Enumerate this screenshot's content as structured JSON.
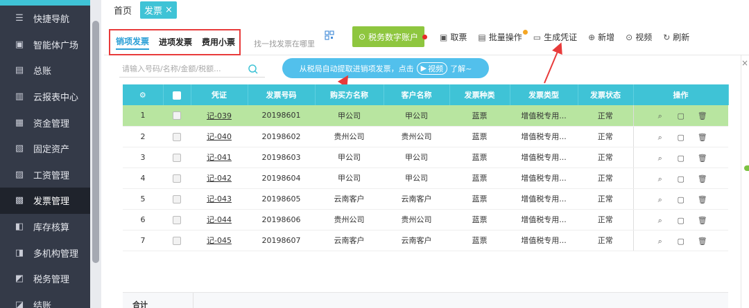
{
  "sidebar": {
    "items": [
      {
        "label": "快捷导航",
        "icon": "navigation-icon"
      },
      {
        "label": "智能体广场",
        "icon": "agent-icon"
      },
      {
        "label": "总账",
        "icon": "ledger-icon"
      },
      {
        "label": "云报表中心",
        "icon": "report-icon"
      },
      {
        "label": "资金管理",
        "icon": "funds-icon"
      },
      {
        "label": "固定资产",
        "icon": "asset-icon"
      },
      {
        "label": "工资管理",
        "icon": "salary-icon"
      },
      {
        "label": "发票管理",
        "icon": "invoice-icon"
      },
      {
        "label": "库存核算",
        "icon": "inventory-icon"
      },
      {
        "label": "多机构管理",
        "icon": "org-icon"
      },
      {
        "label": "税务管理",
        "icon": "tax-icon"
      },
      {
        "label": "结账",
        "icon": "close-book-icon"
      }
    ],
    "active_index": 7
  },
  "tabs": {
    "home": "首页",
    "invoice": "发票",
    "close_glyph": "×"
  },
  "toolbar": {
    "subtabs": [
      "销项发票",
      "进项发票",
      "费用小票"
    ],
    "find_link": "找一找发票在哪里",
    "tax_account": "税务数字账户",
    "buttons": [
      {
        "label": "取票",
        "icon": "fetch-icon"
      },
      {
        "label": "批量操作",
        "icon": "batch-icon"
      },
      {
        "label": "生成凭证",
        "icon": "voucher-icon"
      },
      {
        "label": "新增",
        "icon": "add-icon"
      },
      {
        "label": "视频",
        "icon": "video-icon"
      },
      {
        "label": "刷新",
        "icon": "refresh-icon"
      }
    ]
  },
  "search": {
    "placeholder": "请输入号码/名称/金额/税额..."
  },
  "tip": {
    "text_before": "从税局自动提取进销项发票，点击",
    "video_label": "视频",
    "text_after": "了解~"
  },
  "table": {
    "columns": [
      "凭证",
      "发票号码",
      "购买方名称",
      "客户名称",
      "发票种类",
      "发票类型",
      "发票状态",
      "操作"
    ],
    "rows": [
      {
        "no": "1",
        "voucher": "记-039",
        "number": "20198601",
        "buyer": "甲公司",
        "customer": "甲公司",
        "kind": "蓝票",
        "type": "增值税专用...",
        "status": "正常"
      },
      {
        "no": "2",
        "voucher": "记-040",
        "number": "20198602",
        "buyer": "贵州公司",
        "customer": "贵州公司",
        "kind": "蓝票",
        "type": "增值税专用...",
        "status": "正常"
      },
      {
        "no": "3",
        "voucher": "记-041",
        "number": "20198603",
        "buyer": "甲公司",
        "customer": "甲公司",
        "kind": "蓝票",
        "type": "增值税专用...",
        "status": "正常"
      },
      {
        "no": "4",
        "voucher": "记-042",
        "number": "20198604",
        "buyer": "甲公司",
        "customer": "甲公司",
        "kind": "蓝票",
        "type": "增值税专用...",
        "status": "正常"
      },
      {
        "no": "5",
        "voucher": "记-043",
        "number": "20198605",
        "buyer": "云南客户",
        "customer": "云南客户",
        "kind": "蓝票",
        "type": "增值税专用...",
        "status": "正常"
      },
      {
        "no": "6",
        "voucher": "记-044",
        "number": "20198606",
        "buyer": "贵州公司",
        "customer": "贵州公司",
        "kind": "蓝票",
        "type": "增值税专用...",
        "status": "正常"
      },
      {
        "no": "7",
        "voucher": "记-045",
        "number": "20198607",
        "buyer": "云南客户",
        "customer": "云南客户",
        "kind": "蓝票",
        "type": "增值税专用...",
        "status": "正常"
      }
    ],
    "highlight_row": 0
  },
  "summary": {
    "label": "合计"
  },
  "colors": {
    "accent": "#3fc3d6",
    "sidebar_bg": "#343a48",
    "highlight_row": "#b8e5a0",
    "tax_button": "#8ec63f",
    "annotation": "#e83a3a",
    "tip": "#52c0ec"
  }
}
